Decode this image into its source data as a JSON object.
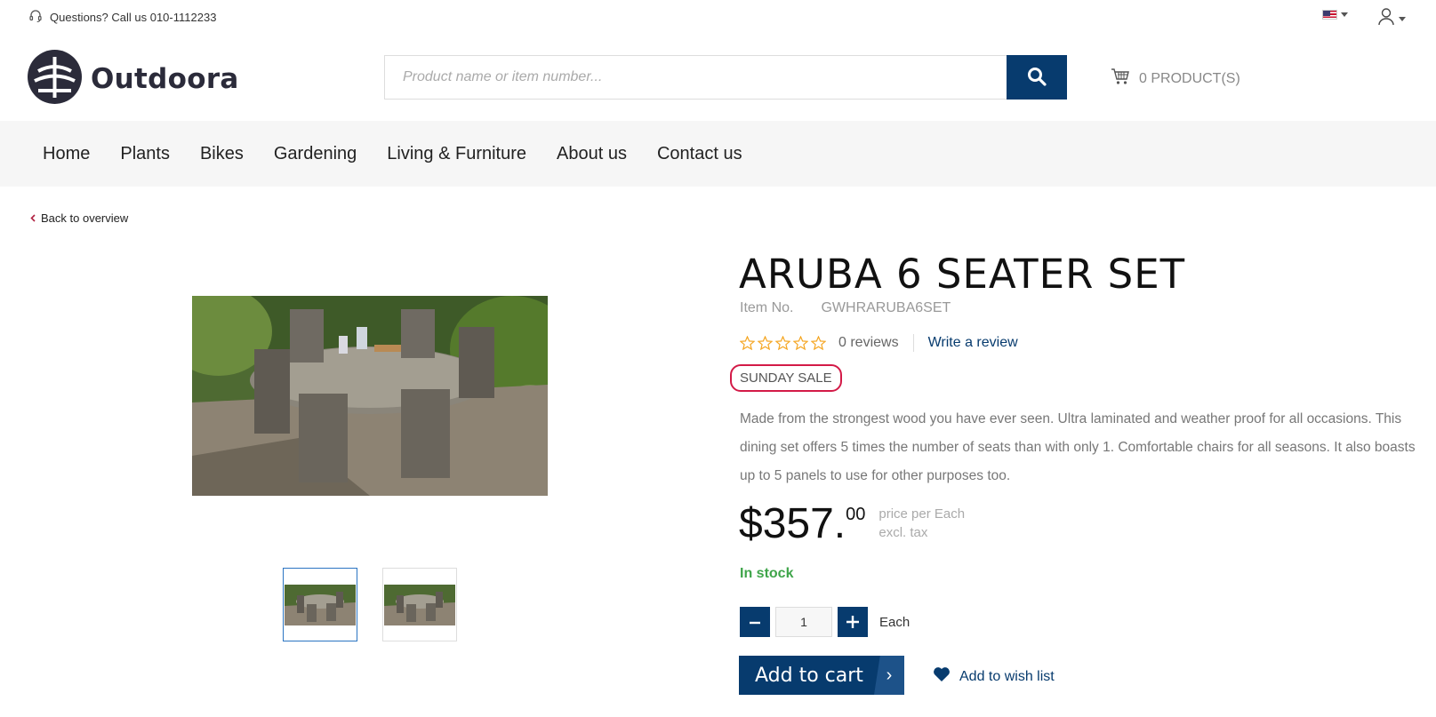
{
  "topbar": {
    "help_text": "Questions? Call us 010-1112233",
    "help_icon": "headset-icon",
    "language": "en-US",
    "language_icon": "us-flag-icon",
    "account_icon": "user-icon"
  },
  "header": {
    "logo_text": "Outdoora",
    "search_placeholder": "Product name or item number...",
    "search_value": "",
    "cart_label": "0 PRODUCT(S)"
  },
  "nav": {
    "items": [
      "Home",
      "Plants",
      "Bikes",
      "Gardening",
      "Living & Furniture",
      "About us",
      "Contact us"
    ]
  },
  "breadcrumb": {
    "back_label": "Back to overview"
  },
  "product": {
    "title": "ARUBA 6 SEATER SET",
    "item_no_label": "Item No.",
    "item_no": "GWHRARUBA6SET",
    "rating": 0,
    "reviews_label": "0 reviews",
    "write_review_label": "Write a review",
    "badge": "SUNDAY SALE",
    "description": "Made from the strongest wood you have ever seen. Ultra laminated and weather proof for all occasions. This dining set offers 5 times the number of seats than with only 1. Comfortable chairs for all seasons. It also boasts up to 5 panels to use for other purposes too.",
    "price_main": "$357.",
    "price_cents": "00",
    "price_per": "price per Each",
    "price_tax": "excl. tax",
    "stock": "In stock",
    "quantity": "1",
    "unit": "Each",
    "add_to_cart": "Add to cart",
    "add_to_cart_arrow": "›",
    "wishlist": "Add to wish list"
  },
  "colors": {
    "primary": "#073b6e",
    "sale_border": "#d31a47",
    "in_stock": "#3fa54a",
    "star": "#f5a623",
    "nav_bg": "#f6f6f6"
  }
}
